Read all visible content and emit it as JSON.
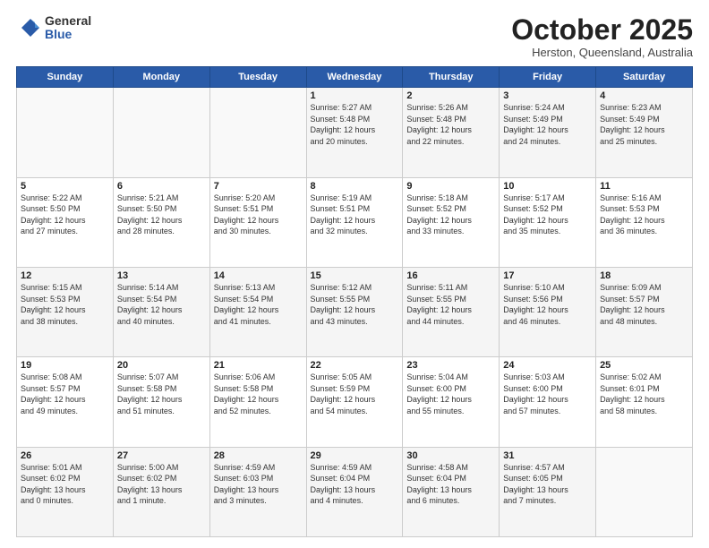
{
  "logo": {
    "general": "General",
    "blue": "Blue"
  },
  "title": "October 2025",
  "subtitle": "Herston, Queensland, Australia",
  "days_header": [
    "Sunday",
    "Monday",
    "Tuesday",
    "Wednesday",
    "Thursday",
    "Friday",
    "Saturday"
  ],
  "weeks": [
    [
      {
        "day": "",
        "info": ""
      },
      {
        "day": "",
        "info": ""
      },
      {
        "day": "",
        "info": ""
      },
      {
        "day": "1",
        "info": "Sunrise: 5:27 AM\nSunset: 5:48 PM\nDaylight: 12 hours\nand 20 minutes."
      },
      {
        "day": "2",
        "info": "Sunrise: 5:26 AM\nSunset: 5:48 PM\nDaylight: 12 hours\nand 22 minutes."
      },
      {
        "day": "3",
        "info": "Sunrise: 5:24 AM\nSunset: 5:49 PM\nDaylight: 12 hours\nand 24 minutes."
      },
      {
        "day": "4",
        "info": "Sunrise: 5:23 AM\nSunset: 5:49 PM\nDaylight: 12 hours\nand 25 minutes."
      }
    ],
    [
      {
        "day": "5",
        "info": "Sunrise: 5:22 AM\nSunset: 5:50 PM\nDaylight: 12 hours\nand 27 minutes."
      },
      {
        "day": "6",
        "info": "Sunrise: 5:21 AM\nSunset: 5:50 PM\nDaylight: 12 hours\nand 28 minutes."
      },
      {
        "day": "7",
        "info": "Sunrise: 5:20 AM\nSunset: 5:51 PM\nDaylight: 12 hours\nand 30 minutes."
      },
      {
        "day": "8",
        "info": "Sunrise: 5:19 AM\nSunset: 5:51 PM\nDaylight: 12 hours\nand 32 minutes."
      },
      {
        "day": "9",
        "info": "Sunrise: 5:18 AM\nSunset: 5:52 PM\nDaylight: 12 hours\nand 33 minutes."
      },
      {
        "day": "10",
        "info": "Sunrise: 5:17 AM\nSunset: 5:52 PM\nDaylight: 12 hours\nand 35 minutes."
      },
      {
        "day": "11",
        "info": "Sunrise: 5:16 AM\nSunset: 5:53 PM\nDaylight: 12 hours\nand 36 minutes."
      }
    ],
    [
      {
        "day": "12",
        "info": "Sunrise: 5:15 AM\nSunset: 5:53 PM\nDaylight: 12 hours\nand 38 minutes."
      },
      {
        "day": "13",
        "info": "Sunrise: 5:14 AM\nSunset: 5:54 PM\nDaylight: 12 hours\nand 40 minutes."
      },
      {
        "day": "14",
        "info": "Sunrise: 5:13 AM\nSunset: 5:54 PM\nDaylight: 12 hours\nand 41 minutes."
      },
      {
        "day": "15",
        "info": "Sunrise: 5:12 AM\nSunset: 5:55 PM\nDaylight: 12 hours\nand 43 minutes."
      },
      {
        "day": "16",
        "info": "Sunrise: 5:11 AM\nSunset: 5:55 PM\nDaylight: 12 hours\nand 44 minutes."
      },
      {
        "day": "17",
        "info": "Sunrise: 5:10 AM\nSunset: 5:56 PM\nDaylight: 12 hours\nand 46 minutes."
      },
      {
        "day": "18",
        "info": "Sunrise: 5:09 AM\nSunset: 5:57 PM\nDaylight: 12 hours\nand 48 minutes."
      }
    ],
    [
      {
        "day": "19",
        "info": "Sunrise: 5:08 AM\nSunset: 5:57 PM\nDaylight: 12 hours\nand 49 minutes."
      },
      {
        "day": "20",
        "info": "Sunrise: 5:07 AM\nSunset: 5:58 PM\nDaylight: 12 hours\nand 51 minutes."
      },
      {
        "day": "21",
        "info": "Sunrise: 5:06 AM\nSunset: 5:58 PM\nDaylight: 12 hours\nand 52 minutes."
      },
      {
        "day": "22",
        "info": "Sunrise: 5:05 AM\nSunset: 5:59 PM\nDaylight: 12 hours\nand 54 minutes."
      },
      {
        "day": "23",
        "info": "Sunrise: 5:04 AM\nSunset: 6:00 PM\nDaylight: 12 hours\nand 55 minutes."
      },
      {
        "day": "24",
        "info": "Sunrise: 5:03 AM\nSunset: 6:00 PM\nDaylight: 12 hours\nand 57 minutes."
      },
      {
        "day": "25",
        "info": "Sunrise: 5:02 AM\nSunset: 6:01 PM\nDaylight: 12 hours\nand 58 minutes."
      }
    ],
    [
      {
        "day": "26",
        "info": "Sunrise: 5:01 AM\nSunset: 6:02 PM\nDaylight: 13 hours\nand 0 minutes."
      },
      {
        "day": "27",
        "info": "Sunrise: 5:00 AM\nSunset: 6:02 PM\nDaylight: 13 hours\nand 1 minute."
      },
      {
        "day": "28",
        "info": "Sunrise: 4:59 AM\nSunset: 6:03 PM\nDaylight: 13 hours\nand 3 minutes."
      },
      {
        "day": "29",
        "info": "Sunrise: 4:59 AM\nSunset: 6:04 PM\nDaylight: 13 hours\nand 4 minutes."
      },
      {
        "day": "30",
        "info": "Sunrise: 4:58 AM\nSunset: 6:04 PM\nDaylight: 13 hours\nand 6 minutes."
      },
      {
        "day": "31",
        "info": "Sunrise: 4:57 AM\nSunset: 6:05 PM\nDaylight: 13 hours\nand 7 minutes."
      },
      {
        "day": "",
        "info": ""
      }
    ]
  ]
}
